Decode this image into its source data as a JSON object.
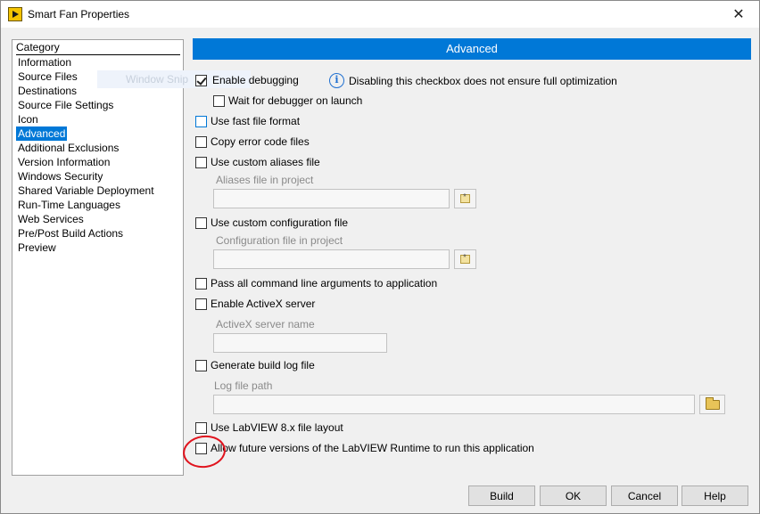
{
  "window": {
    "title": "Smart Fan Properties"
  },
  "sidebar": {
    "header": "Category",
    "items": [
      {
        "label": "Information"
      },
      {
        "label": "Source Files"
      },
      {
        "label": "Destinations"
      },
      {
        "label": "Source File Settings"
      },
      {
        "label": "Icon"
      },
      {
        "label": "Advanced",
        "selected": true
      },
      {
        "label": "Additional Exclusions"
      },
      {
        "label": "Version Information"
      },
      {
        "label": "Windows Security"
      },
      {
        "label": "Shared Variable Deployment"
      },
      {
        "label": "Run-Time Languages"
      },
      {
        "label": "Web Services"
      },
      {
        "label": "Pre/Post Build Actions"
      },
      {
        "label": "Preview"
      }
    ]
  },
  "overlay": {
    "snip_text": "Window Snip"
  },
  "main": {
    "section_title": "Advanced",
    "enable_debugging": {
      "label": "Enable debugging",
      "checked": true
    },
    "info_icon": "info-icon",
    "info_text": "Disabling this checkbox does not ensure full optimization",
    "wait_for_debugger": {
      "label": "Wait for debugger on launch",
      "checked": false
    },
    "fast_file_format": {
      "label": "Use fast file format",
      "checked": false
    },
    "copy_error_code": {
      "label": "Copy error code files",
      "checked": false
    },
    "custom_aliases": {
      "label": "Use custom aliases file",
      "checked": false
    },
    "aliases_field": {
      "label": "Aliases file in project",
      "value": ""
    },
    "custom_config": {
      "label": "Use custom configuration file",
      "checked": false
    },
    "config_field": {
      "label": "Configuration file in project",
      "value": ""
    },
    "pass_cmdline": {
      "label": "Pass all command line arguments to application",
      "checked": false
    },
    "enable_activex": {
      "label": "Enable ActiveX server",
      "checked": false
    },
    "activex_field": {
      "label": "ActiveX server name",
      "value": ""
    },
    "build_log": {
      "label": "Generate build log file",
      "checked": false
    },
    "log_path_field": {
      "label": "Log file path",
      "value": ""
    },
    "labview8_layout": {
      "label": "Use LabVIEW 8.x file layout",
      "checked": false
    },
    "allow_future": {
      "label": "Allow future versions of the LabVIEW Runtime to run this application",
      "checked": false
    }
  },
  "buttons": {
    "build": "Build",
    "ok": "OK",
    "cancel": "Cancel",
    "help": "Help"
  },
  "colors": {
    "accent": "#0078d7",
    "annotation": "#e0141e"
  }
}
